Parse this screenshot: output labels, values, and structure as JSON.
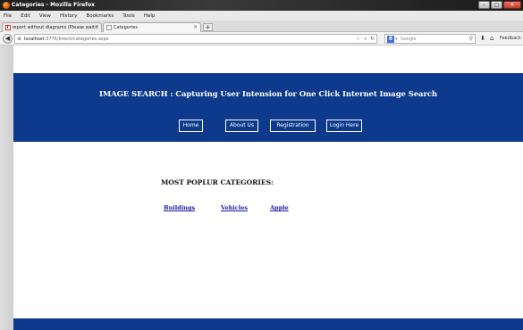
{
  "window": {
    "title": "Categories - Mozilla Firefox"
  },
  "menu": [
    "File",
    "Edit",
    "View",
    "History",
    "Bookmarks",
    "Tools",
    "Help"
  ],
  "tabs": [
    {
      "label": "report without diagrams (Please wait for ...",
      "active": false
    },
    {
      "label": "Categories",
      "active": true
    }
  ],
  "toolbar": {
    "url_host": "localhost",
    "url_path": ":3776/Intent/categories.aspx",
    "search_engine": "Google",
    "feedback_label": "Feedback"
  },
  "page": {
    "colors": {
      "header_bg": "#0d3a8c",
      "link": "#1a1aa6"
    },
    "site_title": "IMAGE SEARCH : Capturing User Intension for One Click Internet Image Search",
    "nav": {
      "home": "Home",
      "about": "About Us",
      "registration": "Registration",
      "login": "Login Here"
    },
    "categories_heading": "MOST POPLUR CATEGORIES:",
    "categories": [
      "Buildings",
      "Vehicles",
      "Apple"
    ]
  }
}
